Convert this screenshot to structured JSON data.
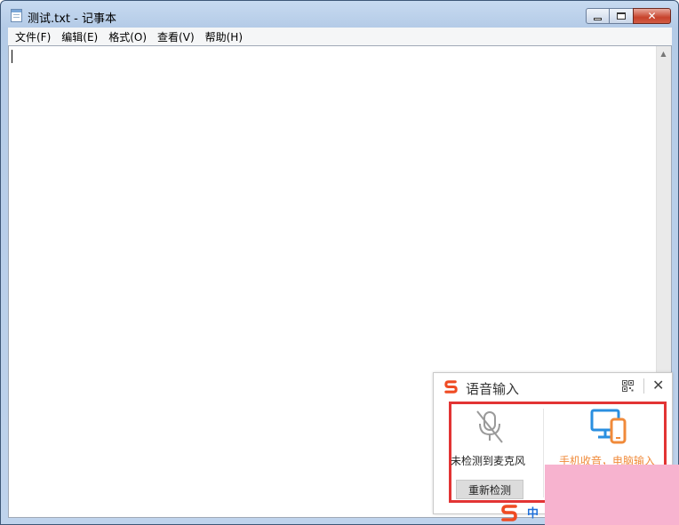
{
  "window": {
    "title": "测试.txt - 记事本",
    "controls": {
      "minimize": "minimize",
      "maximize": "maximize",
      "close": "✕"
    }
  },
  "menu": {
    "items": [
      {
        "label": "文件(F)"
      },
      {
        "label": "编辑(E)"
      },
      {
        "label": "格式(O)"
      },
      {
        "label": "查看(V)"
      },
      {
        "label": "帮助(H)"
      }
    ]
  },
  "editor": {
    "content": ""
  },
  "voice_panel": {
    "title": "语音输入",
    "close_label": "✕",
    "mic_status": "未检测到麦克风",
    "recheck_label": "重新检测",
    "phone_option": "手机收音，电脑输入",
    "accent_color": "#f08a3a",
    "highlight_color": "#e23434"
  },
  "ime": {
    "mode": "中"
  }
}
